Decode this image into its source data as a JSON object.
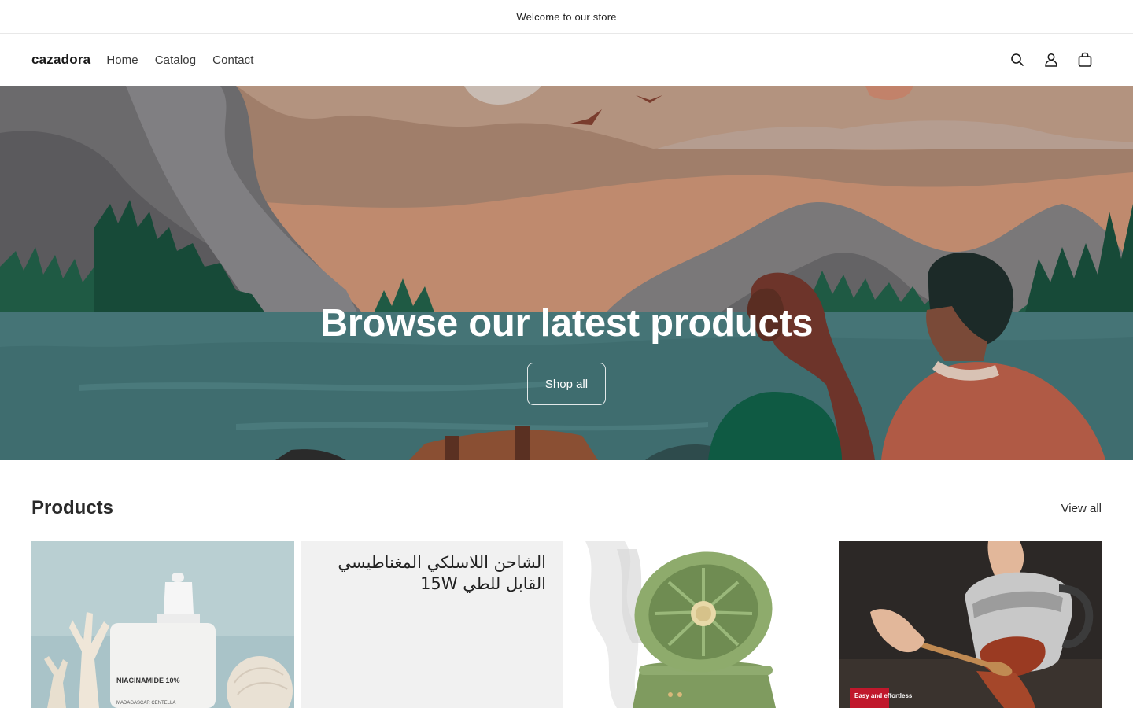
{
  "announcement": {
    "text": "Welcome to our store"
  },
  "header": {
    "logo": "cazadora",
    "nav": [
      {
        "label": "Home"
      },
      {
        "label": "Catalog"
      },
      {
        "label": "Contact"
      }
    ],
    "icons": [
      "search-icon",
      "account-icon",
      "cart-icon"
    ]
  },
  "hero": {
    "title": "Browse our latest products",
    "button_label": "Shop all"
  },
  "products": {
    "title": "Products",
    "view_all_label": "View all",
    "items": [
      {
        "label": "NIACINAMIDE 10%",
        "sublabel": "MADAGASCAR CENTELLA"
      },
      {
        "label": "الشاحن اللاسلكي المغناطيسي القابل للطي 15W"
      },
      {
        "label": ""
      },
      {
        "label": "Easy and effortless"
      }
    ]
  },
  "colors": {
    "hero_water": "#3f6d6f",
    "hero_sky": "#9c7a66",
    "card_gray": "#f1f1f1",
    "text_dark": "#121212"
  }
}
